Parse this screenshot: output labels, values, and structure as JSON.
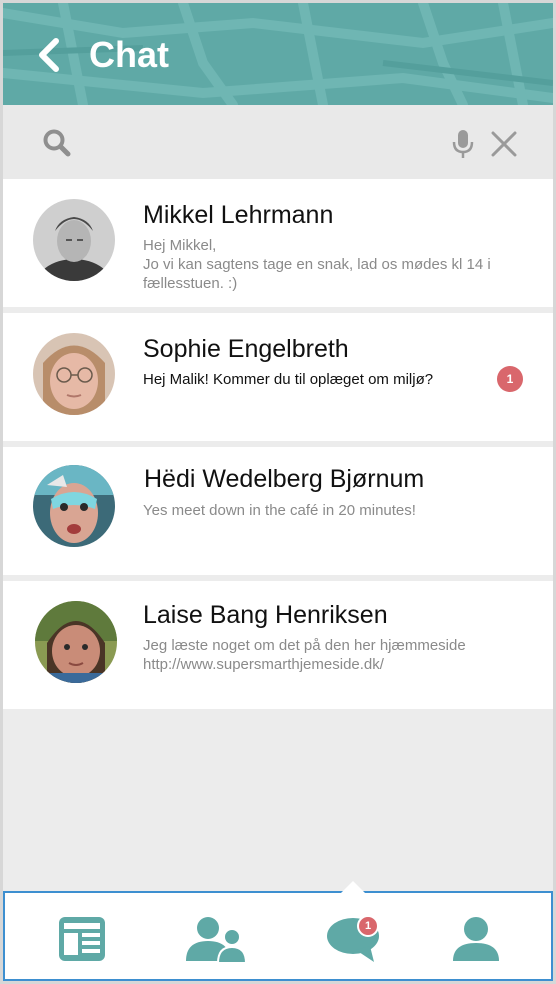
{
  "header": {
    "title": "Chat",
    "back_icon": "chevron-left-icon",
    "accent_color": "#5fa9a6"
  },
  "search": {
    "placeholder": "",
    "value": "",
    "search_icon": "search-icon",
    "mic_icon": "microphone-icon",
    "clear_icon": "close-icon"
  },
  "chats": [
    {
      "name": "Mikkel Lehrmann",
      "message": "Hej Mikkel,\nJo vi kan sagtens tage en snak, lad os mødes kl 14 i fællesstuen. :)",
      "message_line1": "Hej Mikkel,",
      "message_line2": "Jo vi kan sagtens tage en snak, lad os mødes kl 14 i fællesstuen. :)",
      "unread": false,
      "badge": null
    },
    {
      "name": "Sophie Engelbreth",
      "message": "Hej Malik! Kommer du til oplæget om miljø?",
      "unread": true,
      "badge": "1"
    },
    {
      "name": "Hëdi Wedelberg Bjørnum",
      "message": "Yes meet down in the café in 20 minutes!",
      "unread": false,
      "badge": null
    },
    {
      "name": "Laise Bang Henriksen",
      "message_line1": "Jeg læste noget om det på den her hjæmmeside",
      "message_line2": "http://www.supersmarthjemeside.dk/",
      "unread": false,
      "badge": null
    }
  ],
  "bottom_nav": {
    "items": [
      {
        "icon": "news-feed-icon",
        "active": false
      },
      {
        "icon": "contacts-icon",
        "active": false
      },
      {
        "icon": "chat-bubble-icon",
        "active": true,
        "badge": "1"
      },
      {
        "icon": "profile-icon",
        "active": false
      }
    ],
    "badge_color": "#d9676c",
    "icon_color": "#5fa9a6"
  }
}
